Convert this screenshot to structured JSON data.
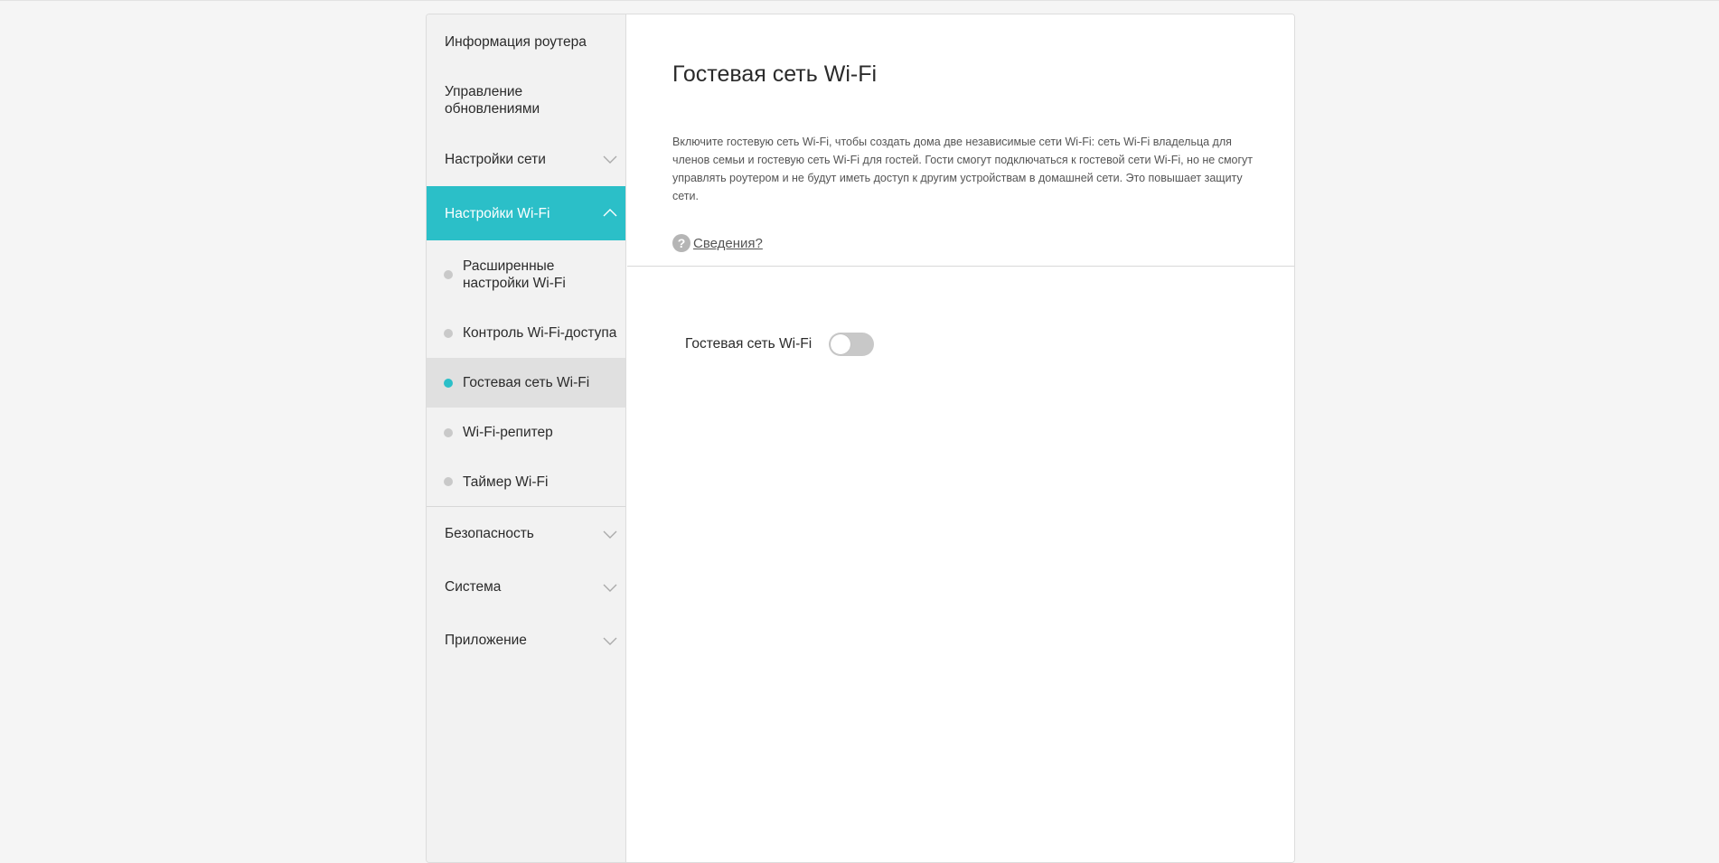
{
  "sidebar": {
    "items": [
      {
        "label": "Информация роутера"
      },
      {
        "label": "Управление обновлениями"
      },
      {
        "label": "Настройки сети"
      },
      {
        "label": "Настройки Wi-Fi"
      },
      {
        "label": "Безопасность"
      },
      {
        "label": "Система"
      },
      {
        "label": "Приложение"
      }
    ],
    "wifi_subitems": [
      {
        "label": "Расширенные настройки Wi-Fi"
      },
      {
        "label": "Контроль Wi-Fi-доступа"
      },
      {
        "label": "Гостевая сеть Wi-Fi"
      },
      {
        "label": "Wi-Fi-репитер"
      },
      {
        "label": "Таймер Wi-Fi"
      }
    ],
    "active_item": "Настройки Wi-Fi",
    "selected_subitem": "Гостевая сеть Wi-Fi"
  },
  "main": {
    "title": "Гостевая сеть Wi-Fi",
    "description": "Включите гостевую сеть Wi-Fi, чтобы создать дома две независимые сети Wi-Fi: сеть Wi-Fi владельца для членов семьи и гостевую сеть Wi-Fi для гостей. Гости смогут подключаться к гостевой сети Wi-Fi, но не смогут управлять роутером и не будут иметь доступ к другим устройствам в домашней сети. Это повышает защиту сети.",
    "help_icon": "?",
    "help_link": "Сведения?",
    "guest_wifi_label": "Гостевая сеть Wi-Fi",
    "guest_wifi_enabled": false
  },
  "colors": {
    "accent": "#2bbfc8",
    "toggle_off": "#c8c8c8"
  }
}
